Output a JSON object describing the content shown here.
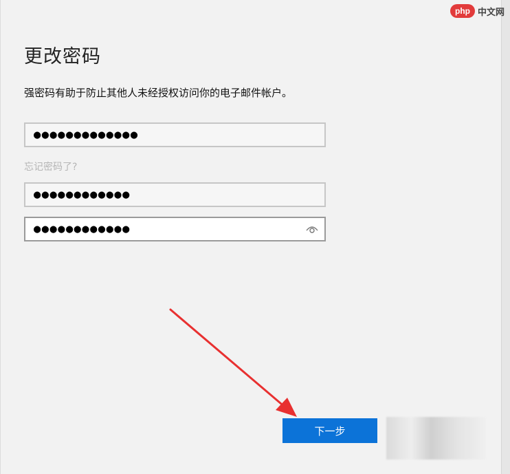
{
  "dialog": {
    "title": "更改密码",
    "subtitle": "强密码有助于防止其他人未经授权访问你的电子邮件帐户。",
    "fields": [
      {
        "value": "●●●●●●●●●●●●●"
      },
      {
        "value": "●●●●●●●●●●●●"
      },
      {
        "value": "●●●●●●●●●●●●"
      }
    ],
    "forgot_link": "忘记密码了?",
    "next_button": "下一步"
  },
  "watermark": {
    "badge": "php",
    "text": "中文网"
  },
  "icons": {
    "reveal": "eye-icon"
  },
  "colors": {
    "accent": "#0c73d8",
    "annotation": "#e83030"
  }
}
